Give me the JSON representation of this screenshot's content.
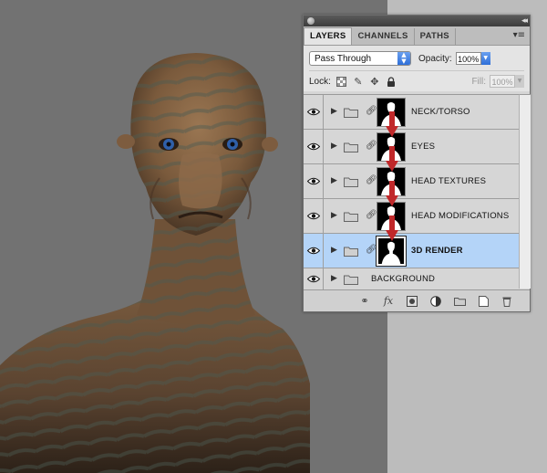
{
  "panel": {
    "tabs": [
      {
        "label": "LAYERS",
        "active": true
      },
      {
        "label": "CHANNELS",
        "active": false
      },
      {
        "label": "PATHS",
        "active": false
      }
    ],
    "blend_mode": "Pass Through",
    "opacity_label": "Opacity:",
    "opacity_value": "100%",
    "lock_label": "Lock:",
    "fill_label": "Fill:",
    "fill_value": "100%"
  },
  "layers": [
    {
      "name": "NECK/TORSO",
      "type": "group",
      "has_mask": true,
      "visible": true,
      "selected": false
    },
    {
      "name": "EYES",
      "type": "group",
      "has_mask": true,
      "visible": true,
      "selected": false
    },
    {
      "name": "HEAD TEXTURES",
      "type": "group",
      "has_mask": true,
      "visible": true,
      "selected": false
    },
    {
      "name": "HEAD MODIFICATIONS",
      "type": "group",
      "has_mask": true,
      "visible": true,
      "selected": false
    },
    {
      "name": "3D RENDER",
      "type": "group",
      "has_mask": true,
      "visible": true,
      "selected": true
    },
    {
      "name": "BACKGROUND",
      "type": "group",
      "has_mask": false,
      "visible": true,
      "selected": false
    }
  ],
  "colors": {
    "selection": "#b4d4f8",
    "arrow": "#c0282a",
    "canvas_bg": "#727272",
    "skin": "#8a6a4a"
  },
  "icons": {
    "footer": [
      "link-icon",
      "fx-icon",
      "add-mask-icon",
      "adjustment-layer-icon",
      "new-group-icon",
      "new-layer-icon",
      "trash-icon"
    ],
    "lock": [
      "lock-transparent-icon",
      "lock-image-icon",
      "lock-position-icon",
      "lock-all-icon"
    ]
  }
}
